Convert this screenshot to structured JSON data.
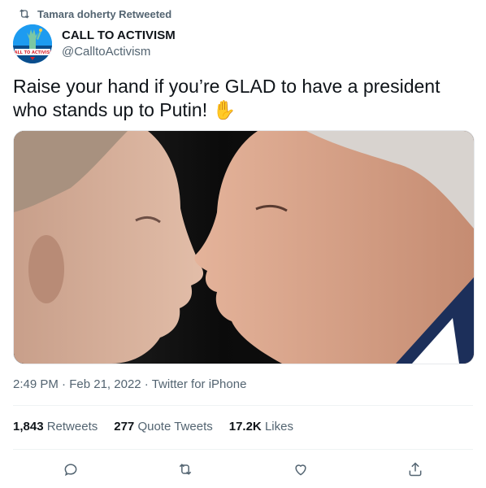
{
  "retweet_context": {
    "text": "Tamara doherty Retweeted",
    "icon": "retweet-icon"
  },
  "author": {
    "name": "CALL TO ACTIVISM",
    "handle": "@CalltoActivism",
    "avatar_text": "CALL TO ACTIVISM"
  },
  "tweet": {
    "text": "Raise your hand if you’re GLAD to have a president who stands up to Putin!",
    "emoji": "✋"
  },
  "media": {
    "description": "Close-up photo of two men facing each other"
  },
  "meta": {
    "time": "2:49 PM",
    "date": "Feb 21, 2022",
    "source": "Twitter for iPhone",
    "separator": "·"
  },
  "stats": {
    "retweets_count": "1,843",
    "retweets_label": "Retweets",
    "quotes_count": "277",
    "quotes_label": "Quote Tweets",
    "likes_count": "17.2K",
    "likes_label": "Likes"
  },
  "actions": [
    "reply-icon",
    "retweet-icon",
    "like-icon",
    "share-icon"
  ],
  "colors": {
    "secondary_text": "#536471",
    "primary_text": "#0f1419",
    "accent": "#1d9bf0"
  }
}
